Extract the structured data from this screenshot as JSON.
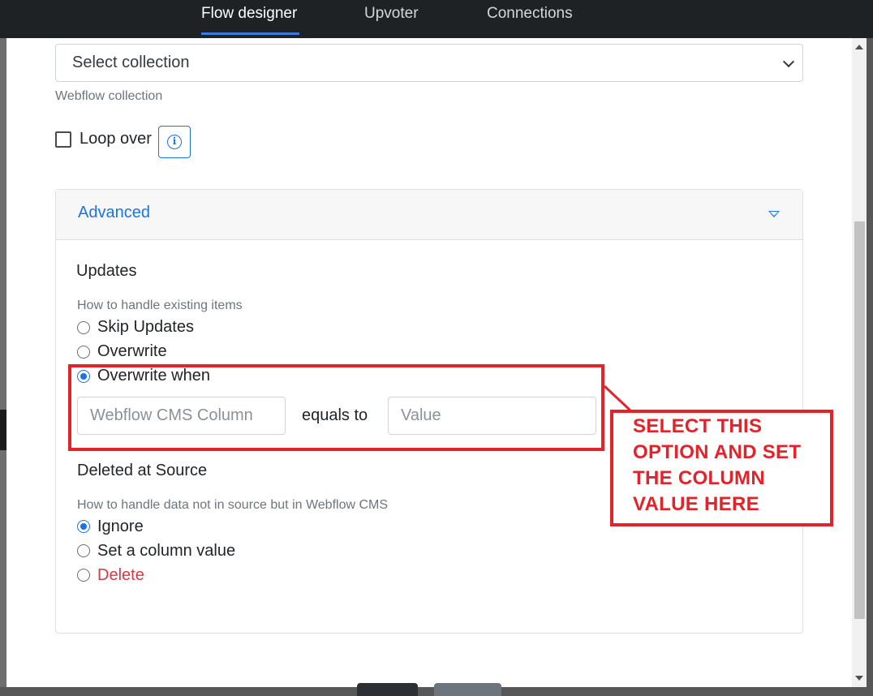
{
  "topnav": {
    "tabs": [
      {
        "label": "Flow designer",
        "active": true
      },
      {
        "label": "Upvoter",
        "active": false
      },
      {
        "label": "Connections",
        "active": false
      }
    ]
  },
  "form": {
    "collection_select": {
      "value": "Select collection",
      "helper": "Webflow collection"
    },
    "loop_over": {
      "label": "Loop over",
      "checked": false
    },
    "info_icon": "info-icon",
    "advanced": {
      "title": "Advanced",
      "updates": {
        "title": "Updates",
        "help": "How to handle existing items",
        "options": [
          {
            "label": "Skip Updates",
            "checked": false
          },
          {
            "label": "Overwrite",
            "checked": false
          },
          {
            "label": "Overwrite when",
            "checked": true
          }
        ],
        "column_placeholder": "Webflow CMS Column",
        "equals_label": "equals to",
        "value_placeholder": "Value"
      },
      "deleted": {
        "title": "Deleted at Source",
        "help": "How to handle data not in source but in Webflow CMS",
        "options": [
          {
            "label": "Ignore",
            "checked": true
          },
          {
            "label": "Set a column value",
            "checked": false
          },
          {
            "label": "Delete",
            "checked": false
          }
        ]
      }
    }
  },
  "annotation": {
    "text": "SELECT THIS OPTION AND SET THE COLUMN VALUE HERE",
    "color": "#e3232a"
  },
  "colors": {
    "accent": "#1a73e8",
    "danger": "#dc3545",
    "navbar": "#1f2225"
  }
}
